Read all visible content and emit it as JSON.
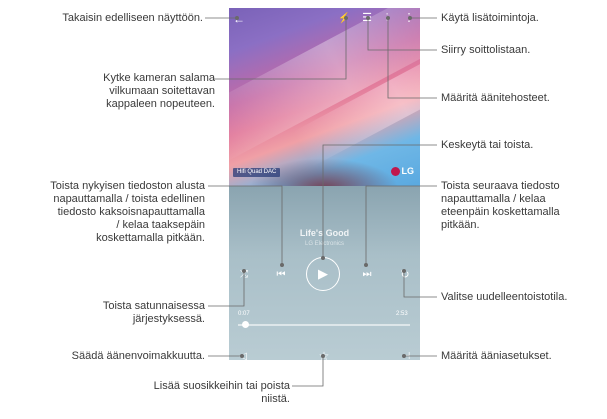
{
  "callouts": {
    "back": "Takaisin edelliseen näyttöön.",
    "more": "Käytä lisätoimintoja.",
    "playlist": "Siirry soittolistaan.",
    "flash_1": "Kytke kameran salama",
    "flash_2": "vilkumaan soitettavan",
    "flash_3": "kappaleen nopeuteen.",
    "effects": "Määritä äänitehosteet.",
    "pause_play": "Keskeytä tai toista.",
    "prev_1": "Toista nykyisen tiedoston alusta",
    "prev_2": "napauttamalla / toista edellinen",
    "prev_3": "tiedosto kaksoisnapauttamalla",
    "prev_4": "/ kelaa taaksepäin",
    "prev_5": "koskettamalla pitkään.",
    "next_1": "Toista seuraava tiedosto",
    "next_2": "napauttamalla / kelaa",
    "next_3": "eteenpäin koskettamalla",
    "next_4": "pitkään.",
    "shuffle_1": "Toista satunnaisessa",
    "shuffle_2": "järjestyksessä.",
    "repeat": "Valitse uudelleentoistotila.",
    "volume": "Säädä äänenvoimakkuutta.",
    "settings": "Määritä ääniasetukset.",
    "favorite_1": "Lisää suosikkeihin tai poista",
    "favorite_2": "niistä."
  },
  "player": {
    "song_title": "Life's Good",
    "artist": "LG Electronics",
    "elapsed": "0:07",
    "duration": "2:53",
    "progress_fraction": 0.04,
    "badge": "Hifi Quad DAC",
    "brand": "LG"
  },
  "icons": {
    "back": "back-arrow-icon",
    "flash": "flash-sync-icon",
    "playlist": "playlist-icon",
    "equalizer": "equalizer-icon",
    "more": "more-options-icon",
    "prev": "previous-track-icon",
    "play": "play-icon",
    "next": "next-track-icon",
    "shuffle": "shuffle-icon",
    "repeat": "repeat-icon",
    "volume": "volume-icon",
    "favorite": "star-icon",
    "settings": "sound-settings-icon"
  }
}
